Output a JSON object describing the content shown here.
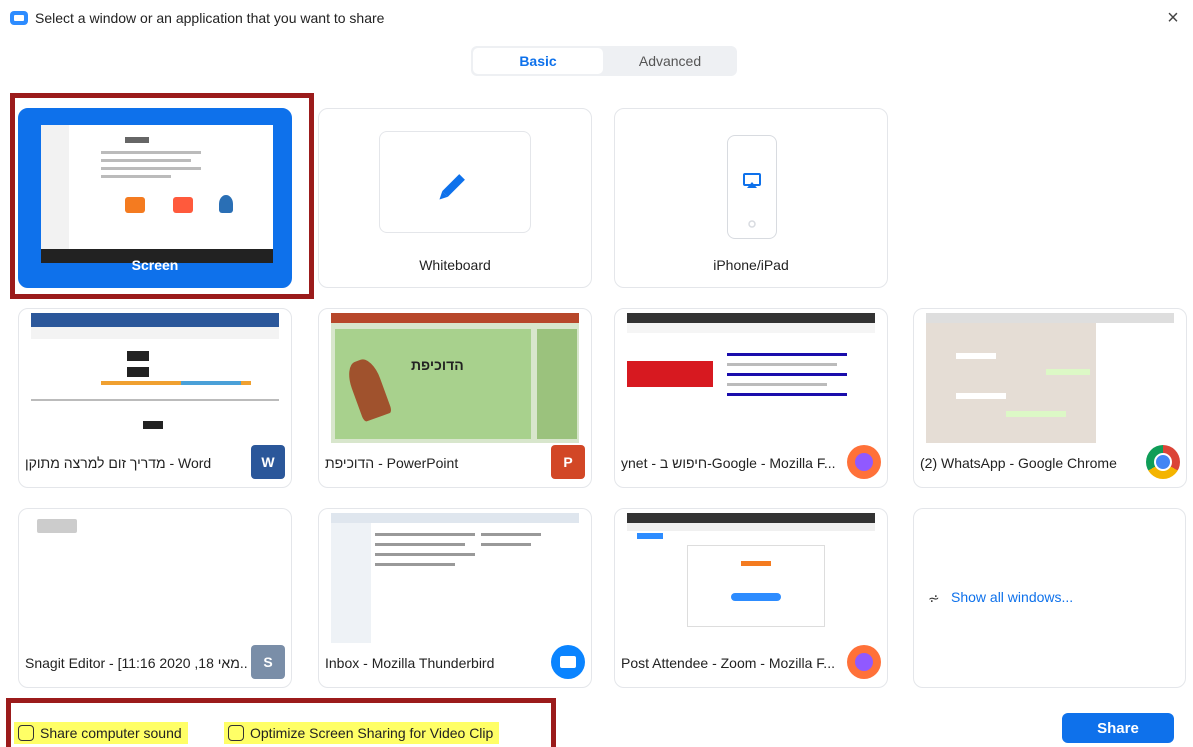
{
  "window": {
    "title": "Select a window or an application that you want to share",
    "close_symbol": "×"
  },
  "tabs": [
    {
      "label": "Basic",
      "selected": true
    },
    {
      "label": "Advanced",
      "selected": false
    }
  ],
  "options": {
    "screen": {
      "label": "Screen"
    },
    "whiteboard": {
      "label": "Whiteboard",
      "icon": "pencil-icon"
    },
    "iphone": {
      "label": "iPhone/iPad",
      "icon": "airplay-icon"
    }
  },
  "windows": [
    {
      "label": "מדריך זום למרצה מתוקן - Word",
      "app": "word-icon"
    },
    {
      "label": "הדוכיפת - PowerPoint",
      "app": "powerpoint-icon",
      "slide_title": "הדוכיפת"
    },
    {
      "label": "ynet - חיפוש ב-Google - Mozilla F...",
      "app": "firefox-icon"
    },
    {
      "label": "(2) WhatsApp - Google Chrome",
      "app": "chrome-icon"
    },
    {
      "label": "Snagit Editor - [11:16 2020 ,18 מאי...",
      "app": "snagit-icon"
    },
    {
      "label": "Inbox - Mozilla Thunderbird",
      "app": "thunderbird-icon"
    },
    {
      "label": "Post Attendee - Zoom - Mozilla F...",
      "app": "firefox-icon"
    }
  ],
  "show_all": {
    "label": "Show all windows...",
    "icon": "expand-icon"
  },
  "footer": {
    "share_sound": "Share computer sound",
    "optimize_video": "Optimize Screen Sharing for Video Clip",
    "share_button": "Share"
  },
  "colors": {
    "accent": "#0e71eb",
    "highlight_frame": "#9b1b1b",
    "option_highlight": "#ffff66"
  }
}
